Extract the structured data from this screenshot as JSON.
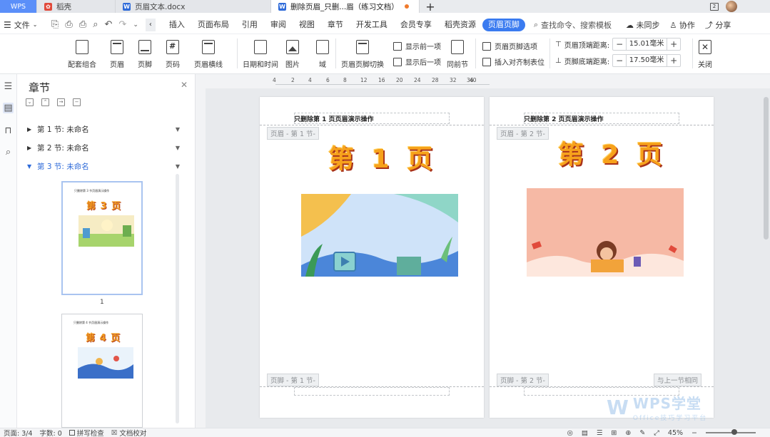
{
  "titlebar": {
    "tabs": [
      {
        "label": "WPS",
        "icon": "wps-logo"
      },
      {
        "label": "稻壳",
        "icon": "docer-icon"
      },
      {
        "label": "页眉文本.docx",
        "icon": "word-doc-icon"
      },
      {
        "label": "删除页眉_只删...眉（练习文档）",
        "icon": "word-doc-icon",
        "active": true
      }
    ],
    "new_tab_label": "+"
  },
  "menubar": {
    "file_label": "文件",
    "items": [
      "插入",
      "页面布局",
      "引用",
      "审阅",
      "视图",
      "章节",
      "开发工具",
      "会员专享",
      "稻壳资源",
      "页眉页脚"
    ],
    "active_item": "页眉页脚",
    "search_placeholder": "查找命令、搜索模板",
    "right_items": [
      "未同步",
      "协作",
      "分享"
    ]
  },
  "ribbon": {
    "buttons": [
      "配套组合",
      "页眉",
      "页脚",
      "页码",
      "页眉横线",
      "日期和时间",
      "图片",
      "域",
      "页眉页脚切换",
      "同前节",
      "关闭"
    ],
    "small_buttons": [
      "显示前一项",
      "显示后一项",
      "页眉页脚选项",
      "插入对齐制表位"
    ],
    "header_distance": {
      "label": "页眉顶端距离:",
      "value": "15.01毫米"
    },
    "footer_distance": {
      "label": "页脚底端距离:",
      "value": "17.50毫米"
    }
  },
  "chapter_panel": {
    "title": "章节",
    "sections": [
      {
        "label": "第 1 节: 未命名",
        "active": false
      },
      {
        "label": "第 2 节: 未命名",
        "active": false
      },
      {
        "label": "第 3 节: 未命名",
        "active": true
      }
    ],
    "thumbnails": [
      {
        "title": "第 3 页",
        "header": "只删除第 3 节页眉演示操作",
        "page_number": "1"
      },
      {
        "title": "第 4 页",
        "header": "只删除第 4 节页眉演示操作",
        "page_number": ""
      }
    ]
  },
  "ruler": {
    "ticks": [
      "4",
      "2",
      "4",
      "6",
      "8",
      "12",
      "16",
      "20",
      "24",
      "28",
      "32",
      "36",
      "40"
    ]
  },
  "pages": [
    {
      "header_text": "只删除第 1 页页眉演示操作",
      "header_tag": "页眉 - 第 1 节-",
      "title": "第 1 页",
      "footer_tag": "页脚 - 第 1 节-"
    },
    {
      "header_text": "只删除第 2 页页眉演示操作",
      "header_tag": "页眉 - 第 2 节-",
      "title": "第 2 页",
      "footer_tag": "页脚 - 第 2 节-",
      "same_as_prev": "与上一节相同"
    }
  ],
  "statusbar": {
    "page": "页面: 3/4",
    "words": "字数: 0",
    "spell_check": "拼写检查",
    "proofread": "文档校对",
    "zoom": "45%"
  },
  "watermark": {
    "brand": "WPS学堂",
    "subtitle": "Office技巧学习平台"
  },
  "colors": {
    "accent": "#3a7bf0",
    "title_orange": "#f7a21b",
    "title_shadow": "#a8321a"
  }
}
